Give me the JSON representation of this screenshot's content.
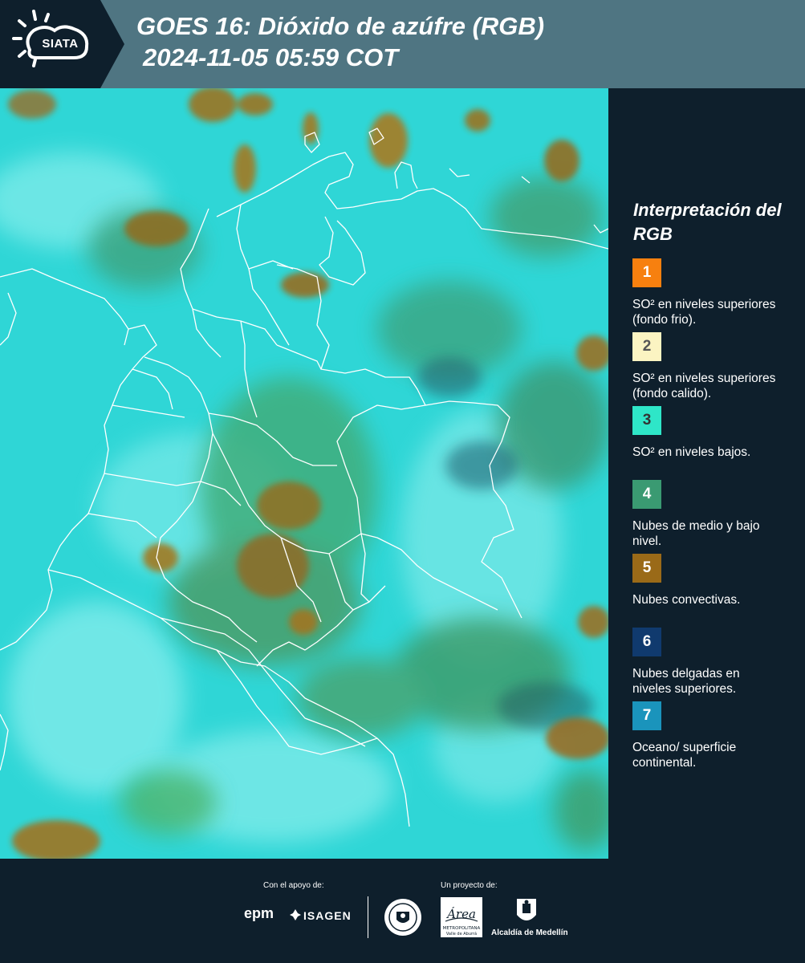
{
  "header": {
    "logo_text": "SIATA",
    "title_line1": "GOES 16: Dióxido de azúfre (RGB)",
    "title_line2": "2024-11-05 05:59 COT"
  },
  "map": {
    "background_color": "#2fd6d6",
    "boundary_color": "#ffffff"
  },
  "legend": {
    "title": "Interpretación del RGB",
    "items": [
      {
        "number": "1",
        "color": "#f7800f",
        "number_color": "#ffffff",
        "description": "SO² en niveles superiores (fondo frio)."
      },
      {
        "number": "2",
        "color": "#fbf4c2",
        "number_color": "#555555",
        "description": "SO² en niveles superiores (fondo calido)."
      },
      {
        "number": "3",
        "color": "#2ee6c8",
        "number_color": "#333333",
        "description": "SO² en niveles bajos."
      },
      {
        "number": "4",
        "color": "#3a9a72",
        "number_color": "#ffffff",
        "description": "Nubes de medio y bajo nivel."
      },
      {
        "number": "5",
        "color": "#9a6a18",
        "number_color": "#ffffff",
        "description": "Nubes convectivas."
      },
      {
        "number": "6",
        "color": "#103a6e",
        "number_color": "#ffffff",
        "description": "Nubes delgadas en niveles superiores."
      },
      {
        "number": "7",
        "color": "#1a94bc",
        "number_color": "#ffffff",
        "description": "Oceano/ superficie continental."
      }
    ]
  },
  "footer": {
    "support_label": "Con el apoyo de:",
    "project_label": "Un proyecto de:",
    "sponsors": [
      "epm",
      "ISAGEN"
    ],
    "partner_label": "Alcaldía de Medellín"
  }
}
